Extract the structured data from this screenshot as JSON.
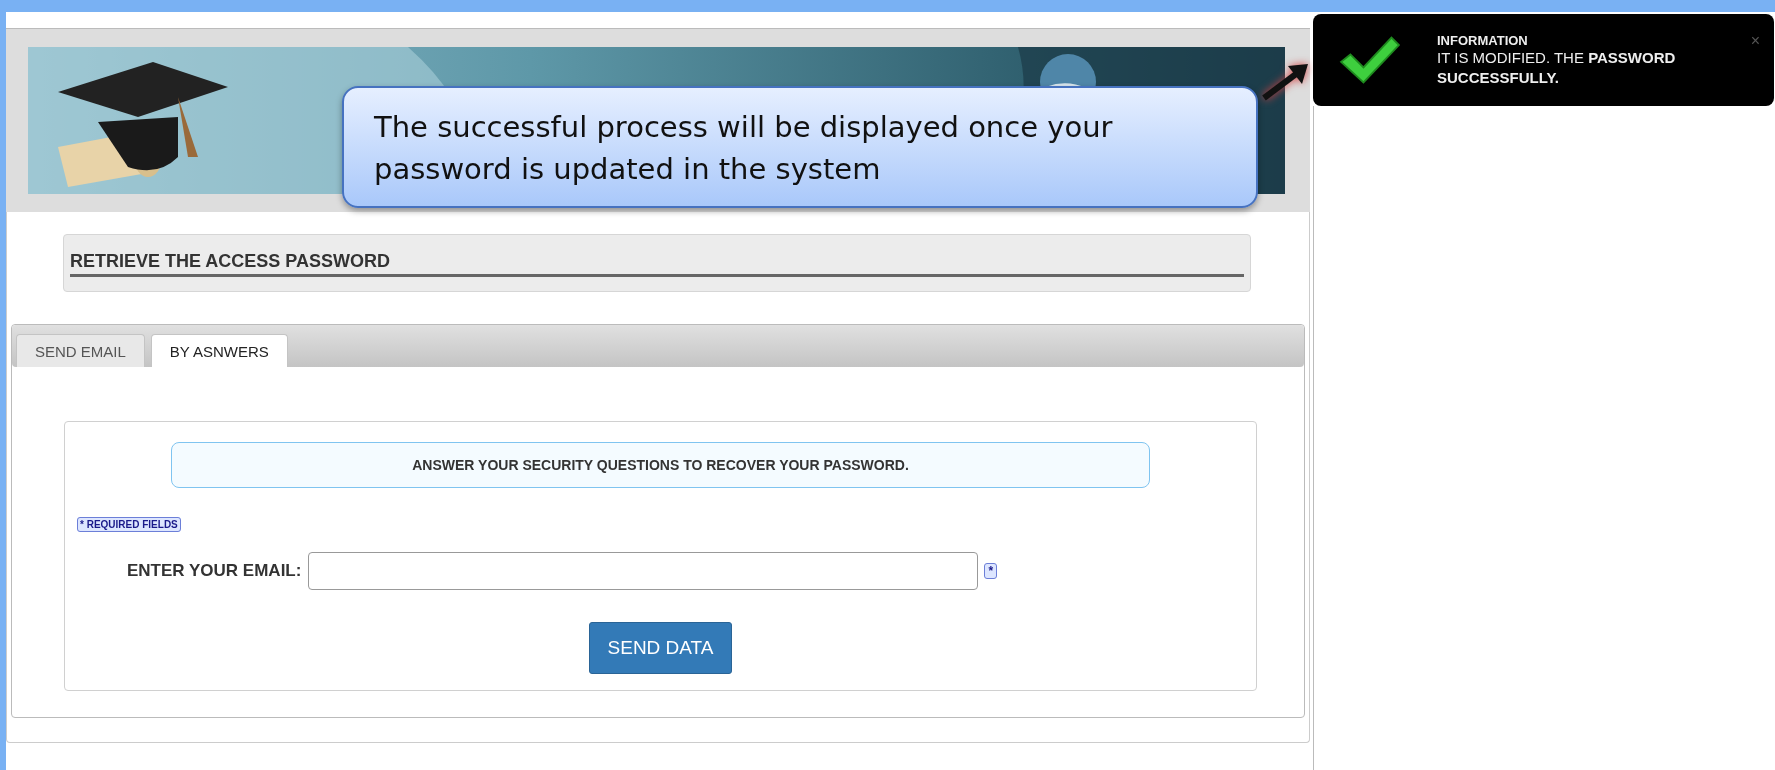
{
  "callout": {
    "text": "The successful process will be displayed once your password is updated in the system"
  },
  "notification": {
    "title": "INFORMATION",
    "message": "IT IS MODIFIED. THE **PASSWORD** **SUCCESSFULLY.**",
    "close": "×"
  },
  "section_title": "RETRIEVE THE ACCESS PASSWORD",
  "tabs": [
    {
      "label": "SEND EMAIL",
      "selected": false
    },
    {
      "label": "BY ASNWERS",
      "selected": true
    }
  ],
  "form": {
    "info": "ANSWER YOUR SECURITY QUESTIONS TO RECOVER YOUR PASSWORD.",
    "required_note": "* REQUIRED FIELDS",
    "email_label": "ENTER YOUR EMAIL:",
    "email_required_mark": "*",
    "submit": "SEND DATA"
  }
}
